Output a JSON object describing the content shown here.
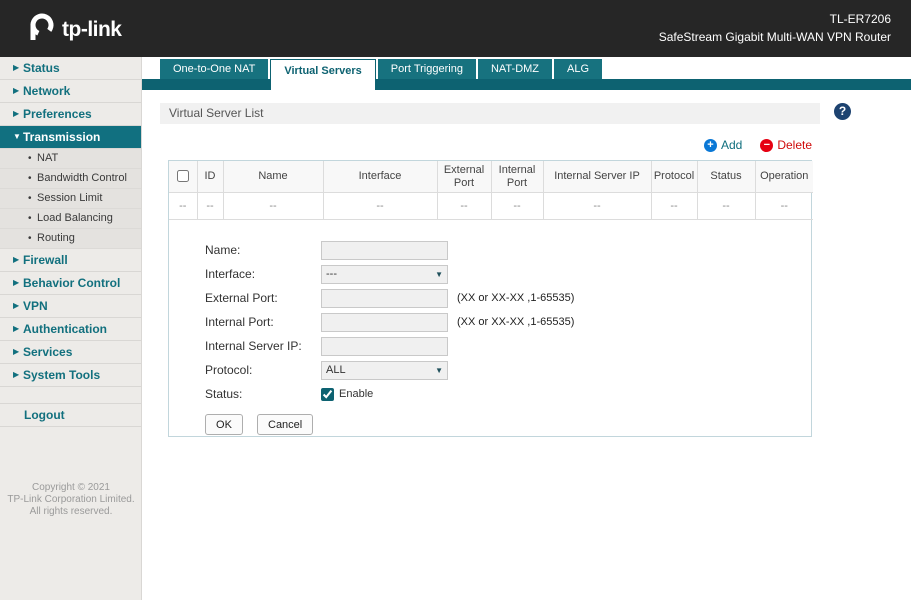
{
  "header": {
    "brand": "tp-link",
    "model": "TL-ER7206",
    "subtitle": "SafeStream Gigabit Multi-WAN VPN Router"
  },
  "tabs": [
    {
      "label": "One-to-One NAT"
    },
    {
      "label": "Virtual Servers"
    },
    {
      "label": "Port Triggering"
    },
    {
      "label": "NAT-DMZ"
    },
    {
      "label": "ALG"
    }
  ],
  "sidebar": {
    "items": [
      {
        "label": "Status"
      },
      {
        "label": "Network"
      },
      {
        "label": "Preferences"
      },
      {
        "label": "Transmission"
      },
      {
        "label": "Firewall"
      },
      {
        "label": "Behavior Control"
      },
      {
        "label": "VPN"
      },
      {
        "label": "Authentication"
      },
      {
        "label": "Services"
      },
      {
        "label": "System Tools"
      }
    ],
    "transmission_children": [
      "NAT",
      "Bandwidth Control",
      "Session Limit",
      "Load Balancing",
      "Routing"
    ],
    "logout": "Logout",
    "copyright": [
      "Copyright © 2021",
      "TP-Link Corporation Limited.",
      "All rights reserved."
    ]
  },
  "main": {
    "section_title": "Virtual Server List",
    "help_label": "?",
    "actions": {
      "add": "Add",
      "delete": "Delete",
      "add_icon": "+",
      "delete_icon": "−"
    },
    "table": {
      "headers": [
        "ID",
        "Name",
        "Interface",
        "External Port",
        "Internal Port",
        "Internal Server IP",
        "Protocol",
        "Status",
        "Operation"
      ],
      "rows": [
        [
          "--",
          "--",
          "--",
          "--",
          "--",
          "--",
          "--",
          "--",
          "--",
          "--"
        ]
      ]
    },
    "form": {
      "fields": [
        {
          "label": "Name:",
          "value": ""
        },
        {
          "label": "Interface:",
          "value": "---"
        },
        {
          "label": "External Port:",
          "value": "",
          "hint": "(XX or XX-XX ,1-65535)"
        },
        {
          "label": "Internal Port:",
          "value": "",
          "hint": "(XX or XX-XX ,1-65535)"
        },
        {
          "label": "Internal Server IP:",
          "value": ""
        },
        {
          "label": "Protocol:",
          "value": "ALL"
        },
        {
          "label": "Status:",
          "checkbox_text": "Enable"
        }
      ],
      "buttons": {
        "ok": "OK",
        "cancel": "Cancel"
      }
    }
  },
  "colors": {
    "header_bg": "#262626",
    "accent_teal": "#0d6271",
    "add_blue": "#0a78d6",
    "delete_red": "#e60012",
    "help_navy": "#1d4370"
  }
}
